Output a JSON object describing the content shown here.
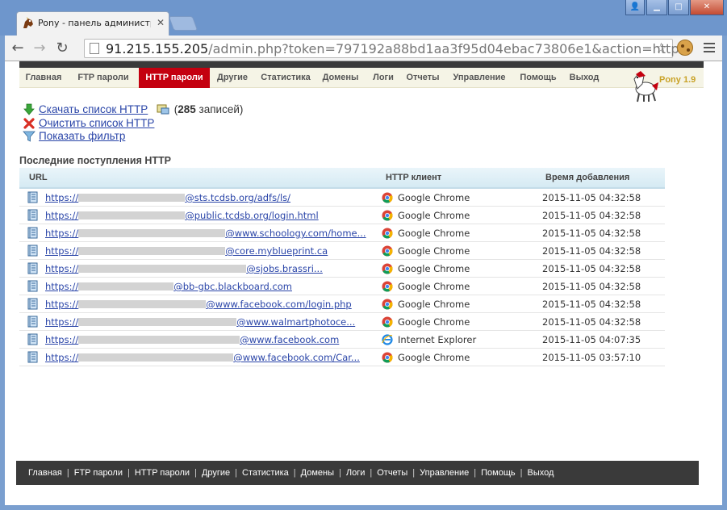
{
  "browser": {
    "tab_title": "Pony - панель администрат",
    "url_host": "91.215.155.205",
    "url_rest": "/admin.php?token=797192a88bd1aa3f95d04ebac73806e1&action=http"
  },
  "nav": {
    "items": [
      "Главная",
      "FTP пароли",
      "HTTP пароли",
      "Другие",
      "Статистика",
      "Домены",
      "Логи",
      "Отчеты",
      "Управление",
      "Помощь",
      "Выход"
    ],
    "active_index": 2
  },
  "logo": {
    "version": "Pony 1.9"
  },
  "actions": {
    "download": "Скачать список HTTP",
    "records_prefix": " (",
    "records_count": "285",
    "records_suffix": " записей)",
    "clear": "Очистить список HTTP",
    "filter": "Показать фильтр"
  },
  "section_title": "Последние поступления HTTP",
  "table": {
    "headers": {
      "url": "URL",
      "client": "HTTP клиент",
      "time": "Время добавления"
    },
    "rows": [
      {
        "prefix": "https://",
        "suffix": "@sts.tcdsb.org/adfs/ls/",
        "client": "Google Chrome",
        "browser": "chrome",
        "time": "2015-11-05 04:32:58"
      },
      {
        "prefix": "https://",
        "suffix": "@public.tcdsb.org/login.html",
        "client": "Google Chrome",
        "browser": "chrome",
        "time": "2015-11-05 04:32:58"
      },
      {
        "prefix": "https://",
        "suffix": "@www.schoology.com/home...",
        "client": "Google Chrome",
        "browser": "chrome",
        "time": "2015-11-05 04:32:58"
      },
      {
        "prefix": "https://",
        "suffix": "@core.myblueprint.ca",
        "client": "Google Chrome",
        "browser": "chrome",
        "time": "2015-11-05 04:32:58"
      },
      {
        "prefix": "https://",
        "suffix": "@sjobs.brassri...",
        "client": "Google Chrome",
        "browser": "chrome",
        "time": "2015-11-05 04:32:58"
      },
      {
        "prefix": "https://",
        "suffix": "@bb-gbc.blackboard.com",
        "client": "Google Chrome",
        "browser": "chrome",
        "time": "2015-11-05 04:32:58"
      },
      {
        "prefix": "https://",
        "suffix": "@www.facebook.com/login.php",
        "client": "Google Chrome",
        "browser": "chrome",
        "time": "2015-11-05 04:32:58"
      },
      {
        "prefix": "https://",
        "suffix": "@www.walmartphotoce...",
        "client": "Google Chrome",
        "browser": "chrome",
        "time": "2015-11-05 04:32:58"
      },
      {
        "prefix": "https://",
        "suffix": "@www.facebook.com",
        "client": "Internet Explorer",
        "browser": "ie",
        "time": "2015-11-05 04:07:35"
      },
      {
        "prefix": "https://",
        "suffix": "@www.facebook.com/Car...",
        "client": "Google Chrome",
        "browser": "chrome",
        "time": "2015-11-05 03:57:10"
      }
    ]
  },
  "footer": {
    "items": [
      "Главная",
      "FTP пароли",
      "HTTP пароли",
      "Другие",
      "Статистика",
      "Домены",
      "Логи",
      "Отчеты",
      "Управление",
      "Помощь",
      "Выход"
    ]
  },
  "colors": {
    "active_nav": "#c4000f",
    "link": "#2a45a8",
    "footer_bg": "#3a3a3a"
  }
}
